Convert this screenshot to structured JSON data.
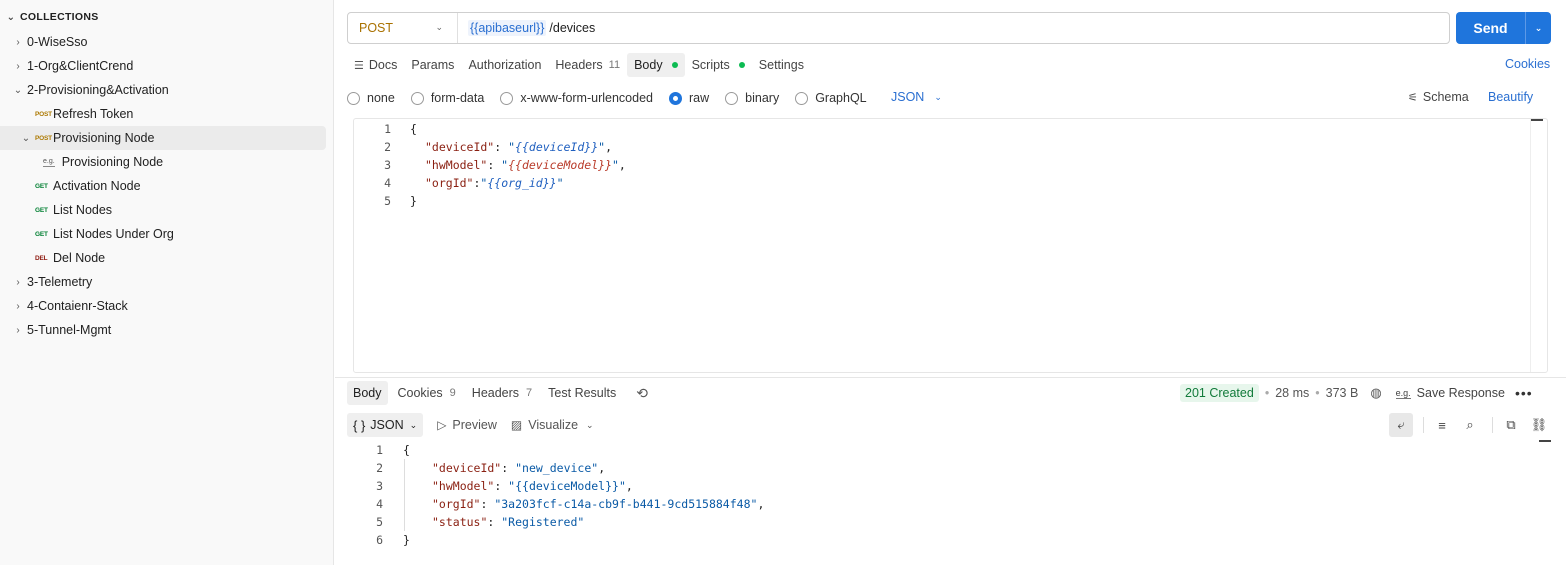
{
  "sidebar": {
    "header": "COLLECTIONS",
    "items": [
      {
        "label": "0-WiseSso"
      },
      {
        "label": "1-Org&ClientCrend"
      },
      {
        "label": "2-Provisioning&Activation"
      },
      {
        "label": "Refresh Token",
        "method": "POST"
      },
      {
        "label": "Provisioning Node",
        "method": "POST"
      },
      {
        "label": "Provisioning Node",
        "example": "e.g."
      },
      {
        "label": "Activation Node",
        "method": "GET"
      },
      {
        "label": "List Nodes",
        "method": "GET"
      },
      {
        "label": "List Nodes Under Org",
        "method": "GET"
      },
      {
        "label": "Del Node",
        "method": "DEL"
      },
      {
        "label": "3-Telemetry"
      },
      {
        "label": "4-Contaienr-Stack"
      },
      {
        "label": "5-Tunnel-Mgmt"
      }
    ]
  },
  "request": {
    "method": "POST",
    "url_var": "{{apibaseurl}}",
    "url_path": "/devices",
    "send_label": "Send",
    "tabs": {
      "docs": "Docs",
      "params": "Params",
      "authorization": "Authorization",
      "headers": "Headers",
      "headers_count": "11",
      "body": "Body",
      "scripts": "Scripts",
      "settings": "Settings"
    },
    "cookies": "Cookies",
    "body_types": [
      "none",
      "form-data",
      "x-www-form-urlencoded",
      "raw",
      "binary",
      "GraphQL"
    ],
    "body_format": "JSON",
    "schema": "Schema",
    "beautify": "Beautify",
    "code": {
      "line_numbers": [
        "1",
        "2",
        "3",
        "4",
        "5"
      ],
      "open": "{",
      "close": "}",
      "deviceId_key": "\"deviceId\"",
      "deviceId_val": "{{deviceId}}",
      "hwModel_key": "\"hwModel\"",
      "hwModel_val": "{{deviceModel}}",
      "orgId_key": "\"orgId\"",
      "orgId_val": "{{org_id}}"
    }
  },
  "response": {
    "tabs": {
      "body": "Body",
      "cookies": "Cookies",
      "cookies_count": "9",
      "headers": "Headers",
      "headers_count": "7",
      "test_results": "Test Results"
    },
    "status": "201 Created",
    "time": "28 ms",
    "size": "373 B",
    "save_response": "Save Response",
    "format": "JSON",
    "preview": "Preview",
    "visualize": "Visualize",
    "code": {
      "line_numbers": [
        "1",
        "2",
        "3",
        "4",
        "5",
        "6"
      ],
      "open": "{",
      "close": "}",
      "deviceId_key": "\"deviceId\"",
      "deviceId_val": "\"new_device\"",
      "hwModel_key": "\"hwModel\"",
      "hwModel_val": "\"{{deviceModel}}\"",
      "orgId_key": "\"orgId\"",
      "orgId_val": "\"3a203fcf-c14a-cb9f-b441-9cd515884f48\"",
      "status_key": "\"status\"",
      "status_val": "\"Registered\""
    }
  },
  "colors": {
    "accent": "#1f75dc",
    "post": "#ad7a03",
    "get": "#007f31",
    "del": "#8e1a10",
    "status_ok": "#117a3a"
  }
}
